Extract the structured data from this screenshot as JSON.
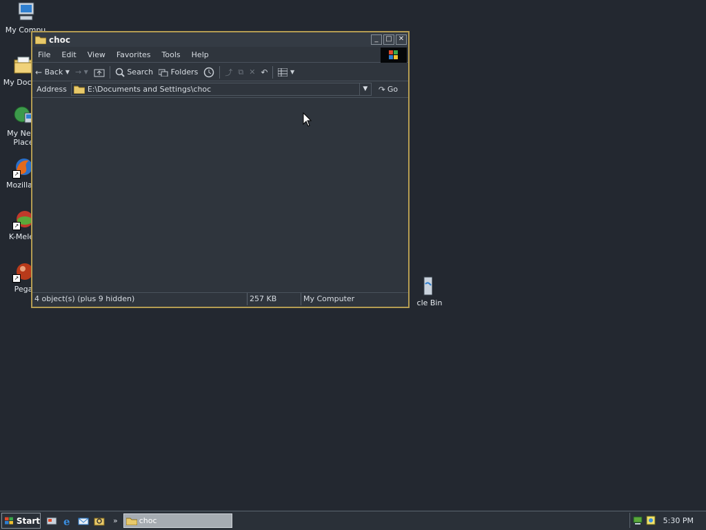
{
  "desktop": {
    "icons": [
      {
        "label": "My Computer",
        "icon": "my-computer-icon"
      },
      {
        "label": "My Documents",
        "icon": "my-documents-icon"
      },
      {
        "label": "My Network Places",
        "icon": "my-network-places-icon"
      },
      {
        "label": "Mozilla Firefox",
        "icon": "firefox-icon"
      },
      {
        "label": "K-Meleon",
        "icon": "k-meleon-icon"
      },
      {
        "label": "Pegasus",
        "icon": "pegasus-icon"
      },
      {
        "label": "Recycle Bin",
        "icon": "recycle-bin-icon"
      }
    ],
    "visible_labels": [
      "My Compu",
      "My Docum",
      "My Netw",
      "Place",
      "Mozilla Fi",
      "K-Melec",
      "Pega",
      "cle Bin"
    ]
  },
  "window": {
    "title": "choc",
    "menu": [
      "File",
      "Edit",
      "View",
      "Favorites",
      "Tools",
      "Help"
    ],
    "toolbar": {
      "back": "Back",
      "search": "Search",
      "folders": "Folders"
    },
    "address": {
      "label": "Address",
      "value": "E:\\Documents and Settings\\choc",
      "go": "Go"
    },
    "status": {
      "objects": "4 object(s) (plus 9 hidden)",
      "size": "257 KB",
      "zone": "My Computer"
    }
  },
  "taskbar": {
    "start": "Start",
    "task_label": "choc",
    "clock": "5:30 PM",
    "chevron": "»"
  },
  "colors": {
    "desktop": "#232830",
    "window_border": "#b59d52",
    "window_bg": "#2f353d"
  }
}
